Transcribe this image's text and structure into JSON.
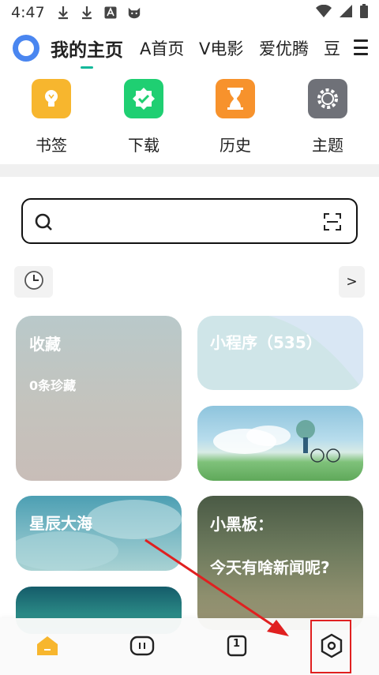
{
  "status_bar": {
    "time": "4:47",
    "icons": [
      "download-icon",
      "download-icon",
      "font-icon",
      "cat-icon"
    ],
    "right_icons": [
      "wifi-icon",
      "signal-icon",
      "battery-icon"
    ]
  },
  "top_nav": {
    "logo": "browser-logo-icon",
    "tabs": [
      {
        "label": "我的主页",
        "active": true
      },
      {
        "label": "A首页",
        "active": false
      },
      {
        "label": "V电影",
        "active": false
      },
      {
        "label": "爱优腾",
        "active": false
      },
      {
        "label": "豆",
        "active": false
      }
    ],
    "menu_icon": "menu-icon",
    "accent_color": "#13b89a"
  },
  "shortcuts": [
    {
      "label": "书签",
      "icon": "lightbulb-icon",
      "color": "#f7b62e"
    },
    {
      "label": "下载",
      "icon": "badge-check-icon",
      "color": "#1fcf72"
    },
    {
      "label": "历史",
      "icon": "hourglass-icon",
      "color": "#f7922c"
    },
    {
      "label": "主题",
      "icon": "gear-icon",
      "color": "#6f7178"
    }
  ],
  "search": {
    "placeholder": "",
    "search_icon": "search-icon",
    "scan_icon": "scan-icon"
  },
  "history_strip": {
    "clock_icon": "clock-icon",
    "more_label": ">"
  },
  "cards": {
    "favorites": {
      "title": "收藏",
      "subtitle": "0条珍藏"
    },
    "mini_programs": {
      "title": "小程序（535）"
    },
    "scenery": {
      "title": ""
    },
    "star_sea": {
      "title": "星辰大海"
    },
    "blackboard": {
      "title": "小黑板：",
      "subtitle": "今天有啥新闻呢?"
    },
    "tree": {
      "title": ""
    }
  },
  "bottom_bar": {
    "items": [
      {
        "icon": "home-icon",
        "active": true
      },
      {
        "icon": "game-icon",
        "active": false
      },
      {
        "icon": "tabs-icon",
        "label": "1",
        "active": false
      },
      {
        "icon": "settings-hexagon-icon",
        "active": false
      }
    ]
  }
}
